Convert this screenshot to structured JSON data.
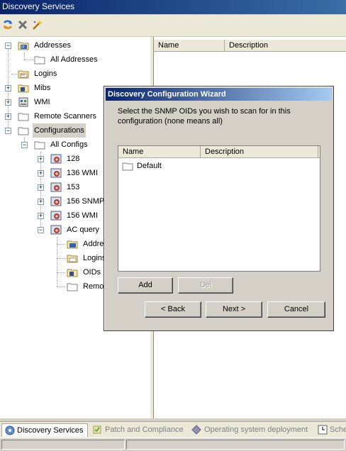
{
  "window": {
    "title": "Discovery Services"
  },
  "tree": {
    "addresses": "Addresses",
    "all_addresses": "All Addresses",
    "logins": "Logins",
    "mibs": "Mibs",
    "wmi": "WMI",
    "remote_scanners": "Remote Scanners",
    "configurations": "Configurations",
    "all_configs": "All Configs",
    "config_128": "128",
    "config_136": "136 WMI",
    "config_153": "153",
    "config_156_snmp": "156 SNMP",
    "config_156_wmi": "156 WMI",
    "ac_query": "AC query",
    "ac_addresses": "Addre",
    "ac_logins": "Logins",
    "ac_oids": "OIDs",
    "ac_remote": "Remo"
  },
  "list": {
    "col_name": "Name",
    "col_description": "Description"
  },
  "dialog": {
    "title": "Discovery Configuration Wizard",
    "instruction": "Select the SNMP OIDs you wish to scan for in this configuration (none means all)",
    "col_name": "Name",
    "col_description": "Description",
    "items": [
      "Default"
    ],
    "add_label": "Add",
    "del_label": "Del",
    "back_label": "< Back",
    "next_label": "Next >",
    "cancel_label": "Cancel"
  },
  "tabs": [
    {
      "label": "Discovery Services",
      "active": true
    },
    {
      "label": "Patch and Compliance",
      "active": false
    },
    {
      "label": "Operating system deployment",
      "active": false
    },
    {
      "label": "Sche",
      "active": false
    }
  ]
}
